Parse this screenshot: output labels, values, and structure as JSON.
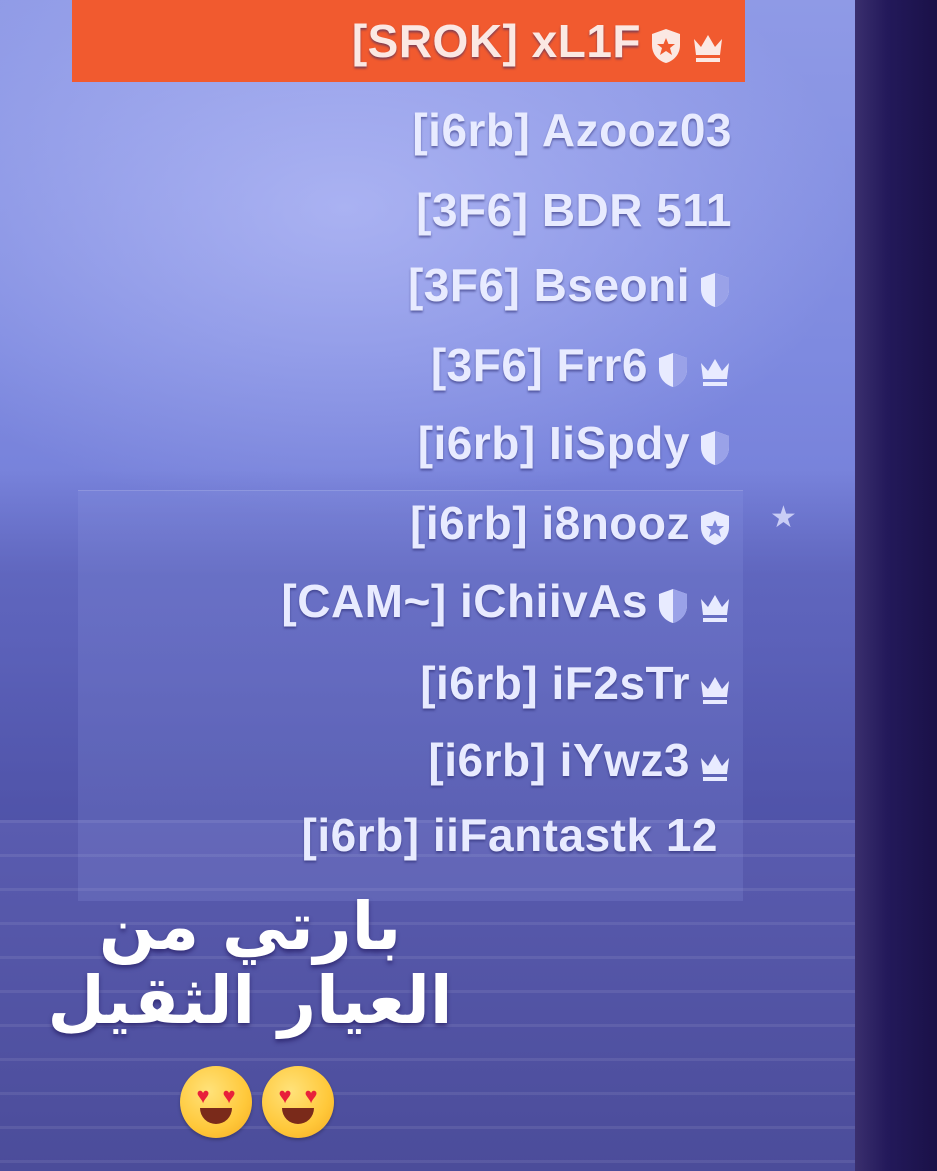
{
  "players": [
    {
      "name": "[SROK] xL1F",
      "badges": [
        "shield-star",
        "crown"
      ],
      "highlighted": true
    },
    {
      "name": "[i6rb] Azooz03",
      "badges": []
    },
    {
      "name": "[3F6] BDR 511",
      "badges": []
    },
    {
      "name": "[3F6] Bseoni",
      "badges": [
        "shield"
      ]
    },
    {
      "name": "[3F6] Frr6",
      "badges": [
        "shield",
        "crown"
      ]
    },
    {
      "name": "[i6rb] IiSpdy",
      "badges": [
        "shield"
      ]
    },
    {
      "name": "[i6rb] i8nooz",
      "badges": [
        "shield-star"
      ]
    },
    {
      "name": "[CAM~] iChiivAs",
      "badges": [
        "shield",
        "crown"
      ]
    },
    {
      "name": "[i6rb] iF2sTr",
      "badges": [
        "crown"
      ]
    },
    {
      "name": "[i6rb] iYwz3",
      "badges": [
        "crown"
      ]
    },
    {
      "name": "[i6rb] iiFantastk 12",
      "badges": []
    }
  ],
  "caption": {
    "line1": "بارتي من",
    "line2": "العيار الثقيل"
  },
  "colors": {
    "highlight": "#f15a2f",
    "text": "#e8ebff"
  }
}
